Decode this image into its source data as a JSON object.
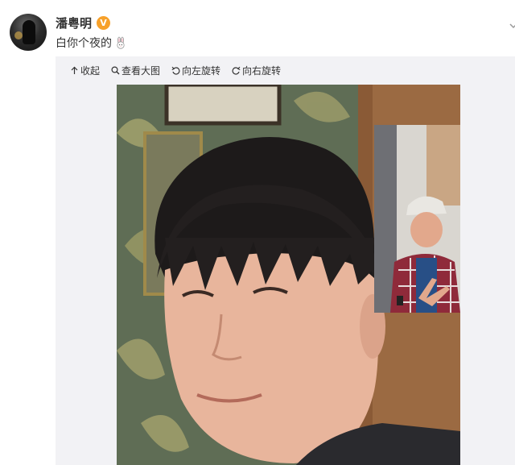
{
  "post": {
    "username": "潘粤明",
    "verified_badge": "V",
    "text": "白你个夜的",
    "text_emoji": "rabbit-emoji"
  },
  "media_toolbar": {
    "collapse_label": "收起",
    "view_large_label": "查看大图",
    "rotate_left_label": "向左旋转",
    "rotate_right_label": "向右旋转"
  },
  "colors": {
    "verified": "#f7a12a",
    "panel_bg": "#f2f2f5",
    "text": "#333333"
  }
}
